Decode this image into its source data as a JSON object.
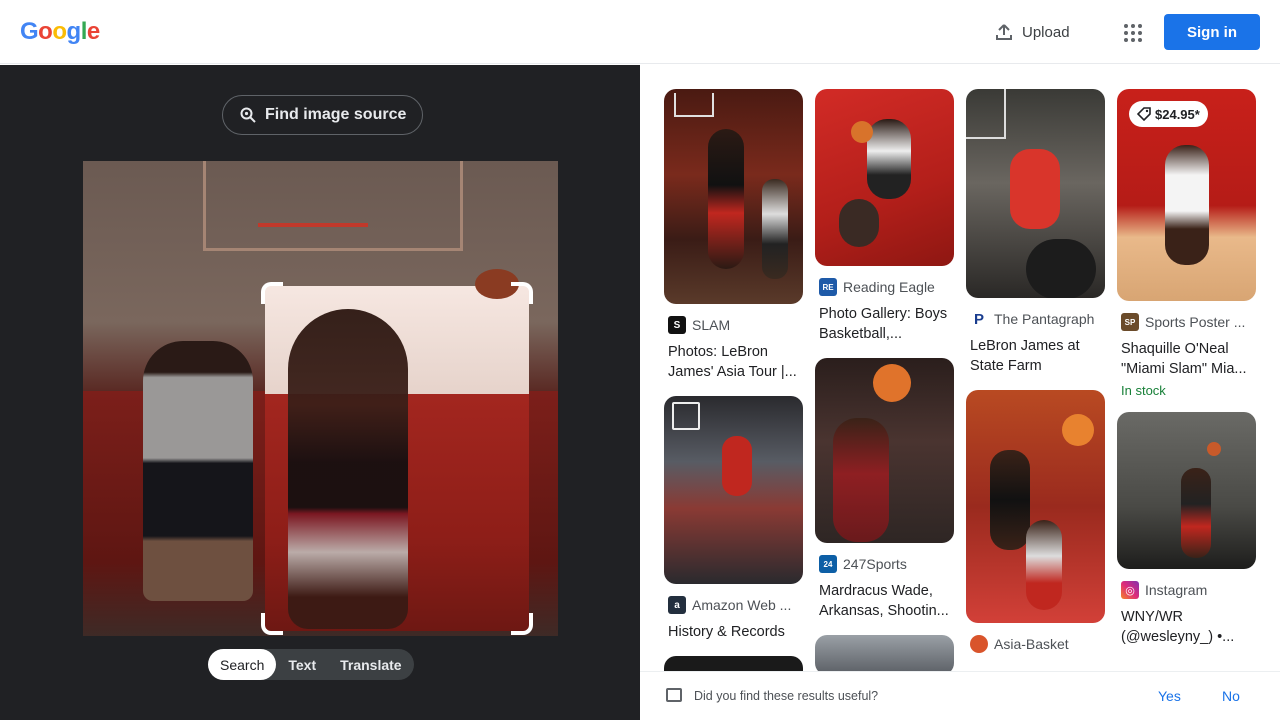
{
  "header": {
    "logo_letters": [
      {
        "ch": "G",
        "color": "#4285F4"
      },
      {
        "ch": "o",
        "color": "#EA4335"
      },
      {
        "ch": "o",
        "color": "#FBBC05"
      },
      {
        "ch": "g",
        "color": "#4285F4"
      },
      {
        "ch": "l",
        "color": "#34A853"
      },
      {
        "ch": "e",
        "color": "#EA4335"
      }
    ],
    "upload_label": "Upload",
    "signin_label": "Sign in"
  },
  "lens": {
    "find_source_label": "Find image source",
    "tabs": [
      "Search",
      "Text",
      "Translate"
    ],
    "active_tab": "Search"
  },
  "results": [
    {
      "source": "SLAM",
      "title": "Photos: LeBron James' Asia Tour |...",
      "favicon": "S",
      "favicon_color": "#111111"
    },
    {
      "source": "Amazon Web ...",
      "title": "History & Records",
      "favicon": "a",
      "favicon_color": "#232f3e"
    },
    {
      "source": "Reading Eagle",
      "title": "Photo Gallery: Boys Basketball,...",
      "favicon": "RE",
      "favicon_color": "#1e5aa8"
    },
    {
      "source": "247Sports",
      "title": "Mardracus Wade, Arkansas, Shootin...",
      "favicon": "24",
      "favicon_color": "#0d5fa6"
    },
    {
      "source": "The Pantagraph",
      "title": "LeBron James at State Farm",
      "favicon": "P",
      "favicon_color": "#1a3d8f"
    },
    {
      "source": "Asia-Basket",
      "title": "",
      "favicon": "",
      "favicon_color": "#d9542b"
    },
    {
      "source": "Sports Poster ...",
      "title": "Shaquille O'Neal \"Miami Slam\" Mia...",
      "favicon": "SP",
      "favicon_color": "#6b4b2a",
      "price": "$24.95*",
      "stock": "In stock"
    },
    {
      "source": "Instagram",
      "title": "WNY/WR (@wesleyny_) •...",
      "favicon": "◎",
      "favicon_color": "#e1306c"
    }
  ],
  "feedback": {
    "question": "Did you find these results useful?",
    "yes": "Yes",
    "no": "No"
  }
}
